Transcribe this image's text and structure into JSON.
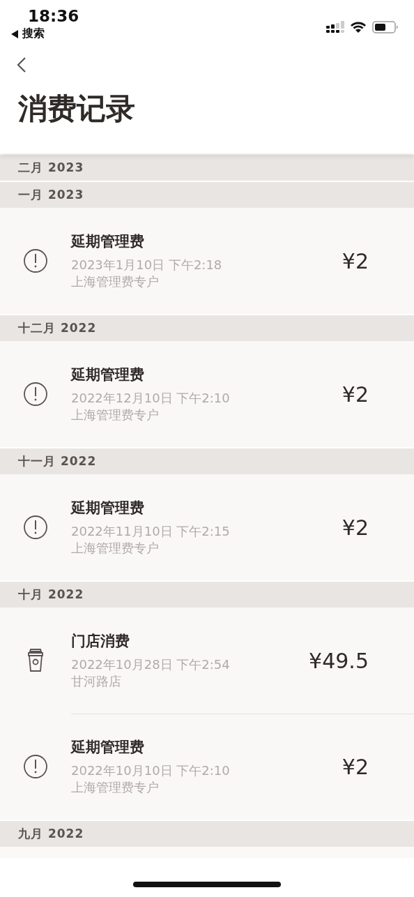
{
  "status_bar": {
    "time": "18:36",
    "back_label": "搜索"
  },
  "page": {
    "title": "消费记录"
  },
  "sections": [
    {
      "title": "二月 2023"
    },
    {
      "title": "一月 2023",
      "records": [
        {
          "kind": "fee",
          "name": "延期管理费",
          "date": "2023年1月10日 下午2:18",
          "place": "上海管理费专户",
          "amount": "¥2"
        }
      ]
    },
    {
      "title": "十二月 2022",
      "records": [
        {
          "kind": "fee",
          "name": "延期管理费",
          "date": "2022年12月10日 下午2:10",
          "place": "上海管理费专户",
          "amount": "¥2"
        }
      ]
    },
    {
      "title": "十一月 2022",
      "records": [
        {
          "kind": "fee",
          "name": "延期管理费",
          "date": "2022年11月10日 下午2:15",
          "place": "上海管理费专户",
          "amount": "¥2"
        }
      ]
    },
    {
      "title": "十月 2022",
      "records": [
        {
          "kind": "store",
          "name": "门店消费",
          "date": "2022年10月28日 下午2:54",
          "place": "甘河路店",
          "amount": "¥49.5"
        },
        {
          "kind": "fee",
          "name": "延期管理费",
          "date": "2022年10月10日 下午2:10",
          "place": "上海管理费专户",
          "amount": "¥2"
        }
      ]
    },
    {
      "title": "九月 2022"
    }
  ]
}
